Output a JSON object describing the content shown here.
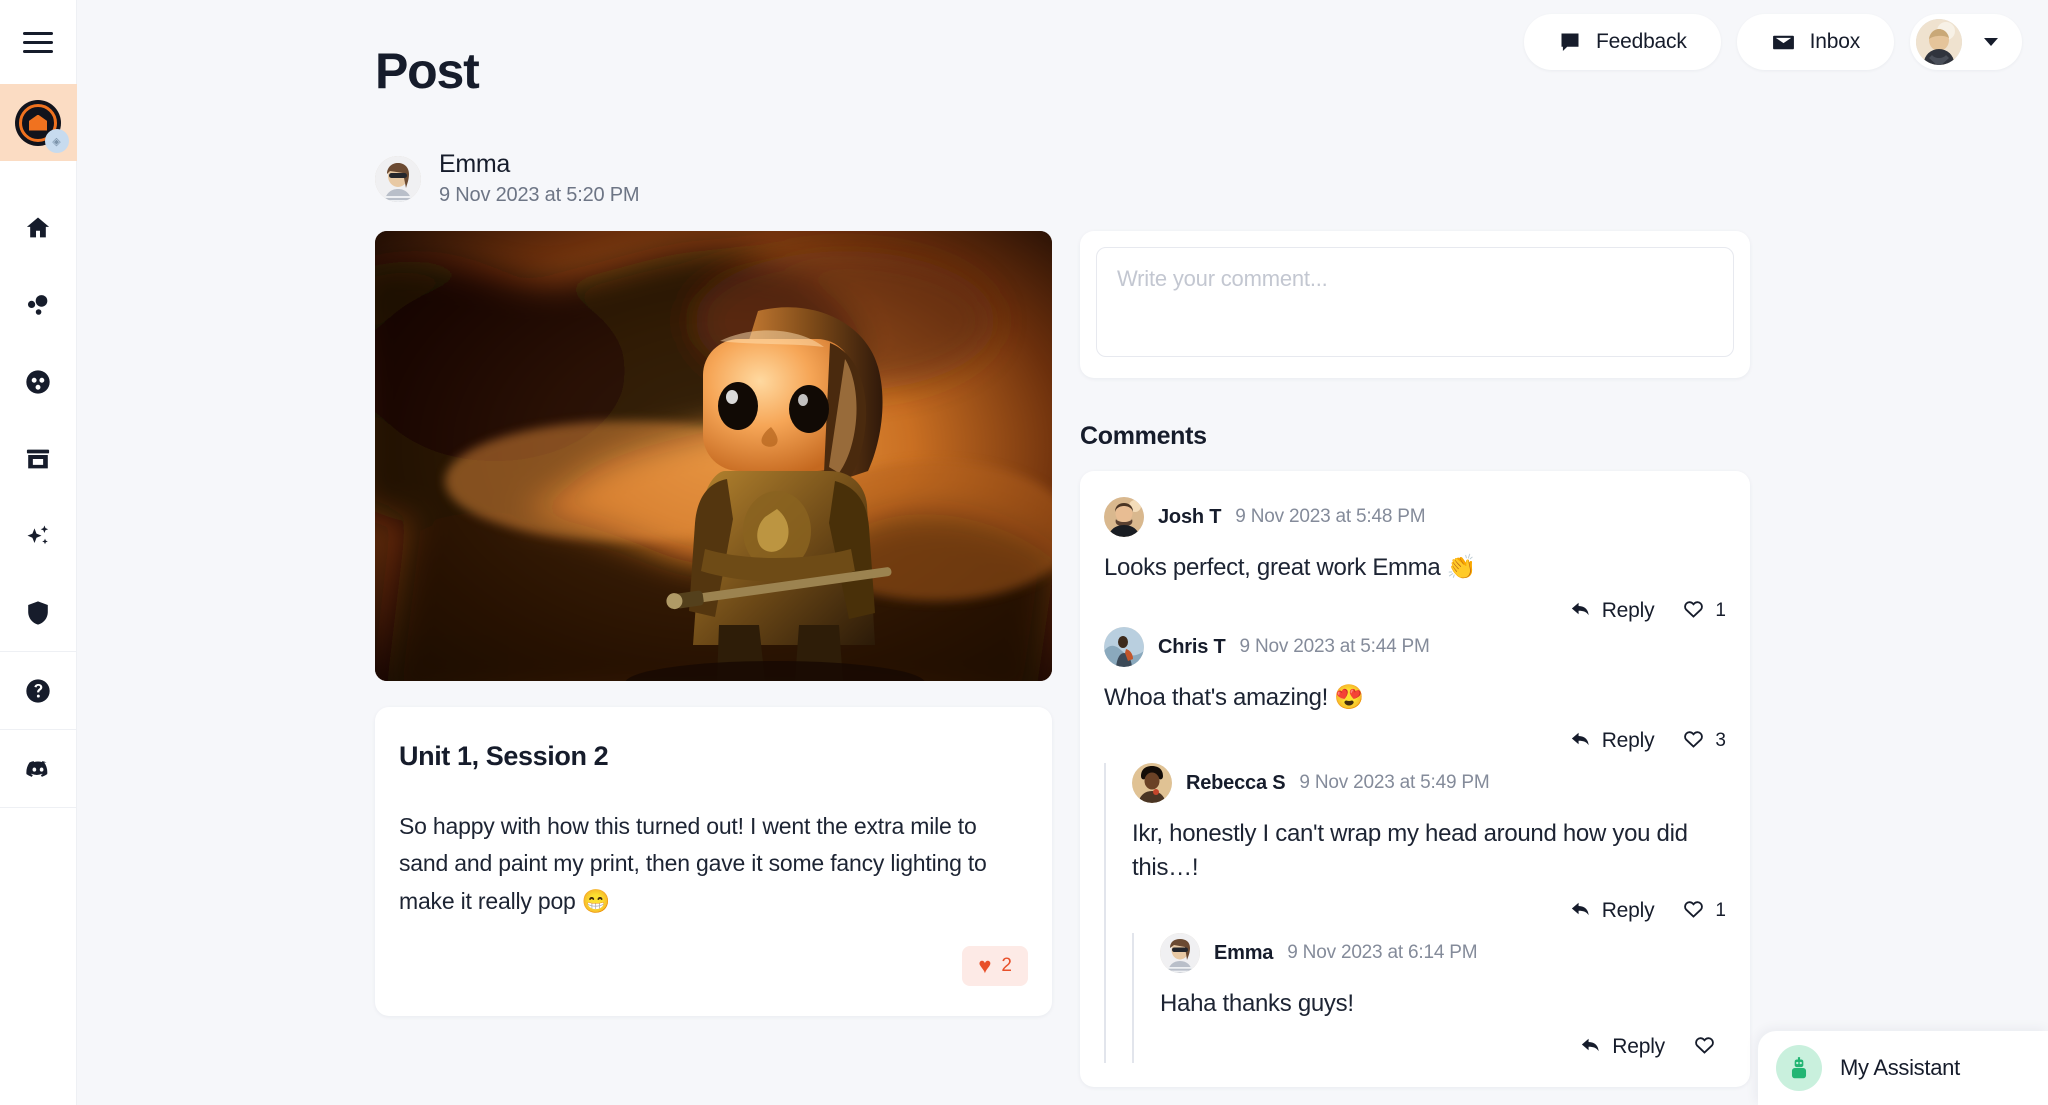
{
  "sidebar": {
    "menu_button": "hamburger-menu",
    "logo": {
      "name": "workspace-logo",
      "badge": "diamond-badge"
    },
    "items": [
      {
        "icon": "home-icon",
        "name": "home"
      },
      {
        "icon": "bubbles-icon",
        "name": "community"
      },
      {
        "icon": "filament-icon",
        "name": "filament"
      },
      {
        "icon": "storefront-icon",
        "name": "store"
      },
      {
        "icon": "sparkles-icon",
        "name": "ai"
      },
      {
        "icon": "shield-icon",
        "name": "safety"
      }
    ],
    "footer_items": [
      {
        "icon": "help-icon",
        "name": "help"
      },
      {
        "icon": "discord-icon",
        "name": "discord"
      }
    ]
  },
  "topbar": {
    "feedback_label": "Feedback",
    "feedback_icon": "feedback-chat-icon",
    "inbox_label": "Inbox",
    "inbox_icon": "envelope-icon",
    "avatar_name": "user-avatar",
    "caret_icon": "chevron-down-icon"
  },
  "page": {
    "title": "Post"
  },
  "post": {
    "author": "Emma",
    "date": "9 Nov 2023 at 5:20 PM",
    "image_alt": "knight-figurine-photo",
    "card_title": "Unit 1, Session 2",
    "body": "So happy with how this turned out! I went the extra mile to sand and paint my print, then gave it some fancy lighting to make it really pop 😁",
    "reaction": {
      "emoji": "♥",
      "count": "2"
    }
  },
  "composer": {
    "placeholder": "Write your comment...",
    "value": ""
  },
  "comments": {
    "heading": "Comments",
    "reply_label": "Reply",
    "items": [
      {
        "author": "Josh T",
        "date": "9 Nov 2023 at 5:48 PM",
        "text": "Looks perfect, great work Emma 👏",
        "likes": "1",
        "depth": 0
      },
      {
        "author": "Chris T",
        "date": "9 Nov 2023 at 5:44 PM",
        "text": "Whoa that's amazing! 😍",
        "likes": "3",
        "depth": 0
      },
      {
        "author": "Rebecca S",
        "date": "9 Nov 2023 at 5:49 PM",
        "text": "Ikr, honestly I can't wrap my head around how you did this…!",
        "likes": "1",
        "depth": 1
      },
      {
        "author": "Emma",
        "date": "9 Nov 2023 at 6:14 PM",
        "text": "Haha thanks guys!",
        "likes": "",
        "depth": 2
      }
    ]
  },
  "assistant": {
    "label": "My Assistant",
    "icon": "robot-icon"
  },
  "colors": {
    "background": "#f6f7fa",
    "card": "#ffffff",
    "text": "#161c2b",
    "muted": "#848b9a",
    "accent_orange": "#f0721f",
    "logo_bg": "#fbdcc3",
    "reaction_bg": "#fdeae6",
    "reaction_fg": "#e8502a",
    "assistant_green": "#22b573"
  }
}
